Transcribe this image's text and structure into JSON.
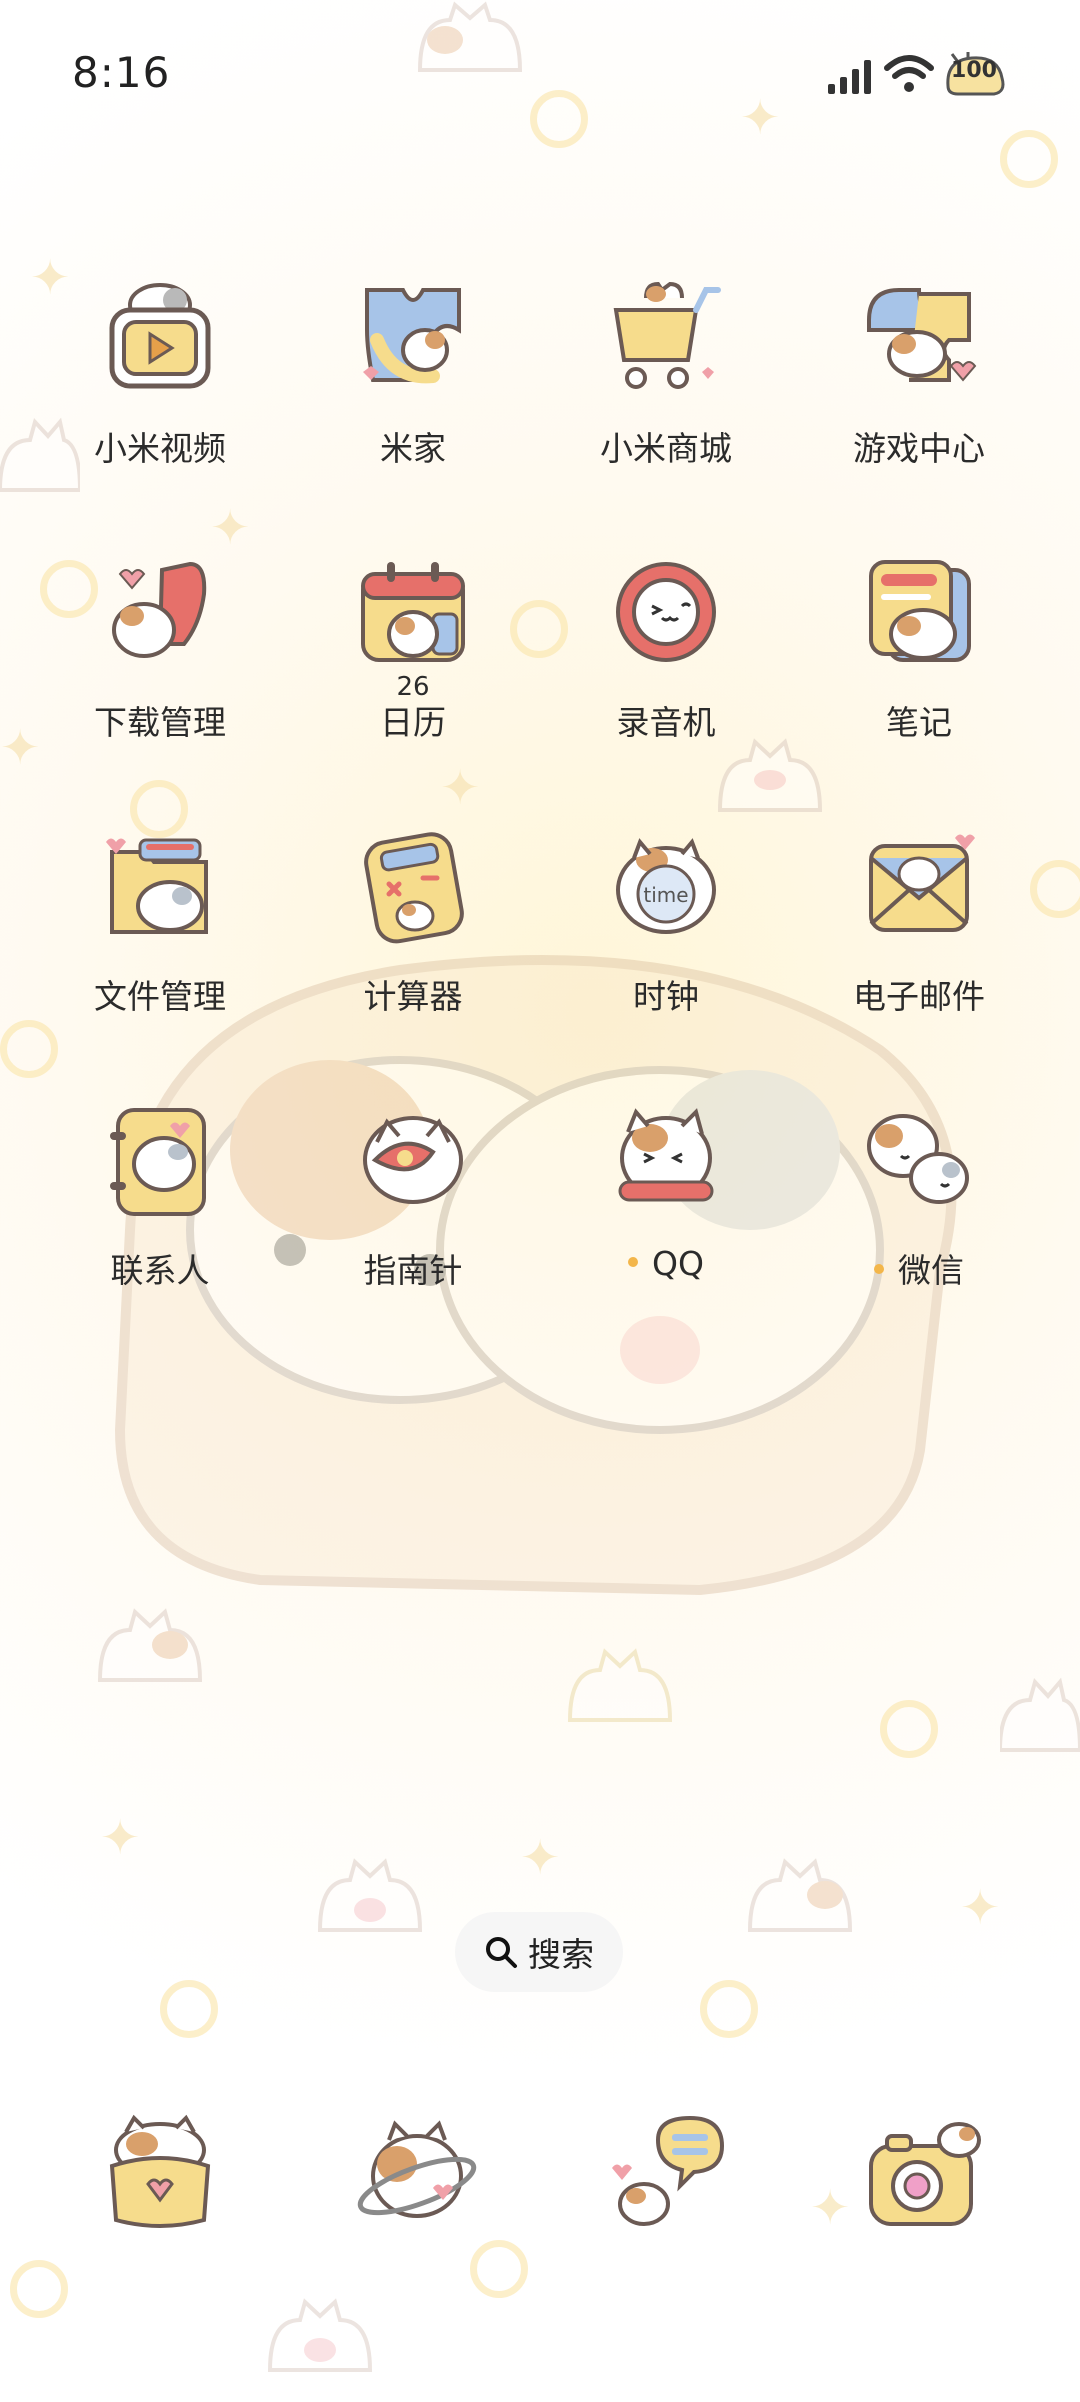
{
  "status_bar": {
    "time": "8:16",
    "battery_level": "100",
    "icons": [
      "signal-icon",
      "wifi-icon",
      "battery-icon"
    ]
  },
  "apps": [
    {
      "label": "小米视频",
      "icon": "video-icon"
    },
    {
      "label": "米家",
      "icon": "home-icon"
    },
    {
      "label": "小米商城",
      "icon": "shopping-cart-icon"
    },
    {
      "label": "游戏中心",
      "icon": "puzzle-icon"
    },
    {
      "label": "下载管理",
      "icon": "download-icon"
    },
    {
      "label": "日历",
      "icon": "calendar-icon",
      "date": "26"
    },
    {
      "label": "录音机",
      "icon": "recorder-icon"
    },
    {
      "label": "笔记",
      "icon": "notes-icon"
    },
    {
      "label": "文件管理",
      "icon": "folder-icon"
    },
    {
      "label": "计算器",
      "icon": "calculator-icon"
    },
    {
      "label": "时钟",
      "icon": "clock-icon",
      "icon_text": "time"
    },
    {
      "label": "电子邮件",
      "icon": "mail-icon"
    },
    {
      "label": "联系人",
      "icon": "contacts-icon"
    },
    {
      "label": "指南针",
      "icon": "compass-icon"
    },
    {
      "label": "QQ",
      "icon": "qq-icon",
      "new_dot": true
    },
    {
      "label": "微信",
      "icon": "wechat-icon",
      "new_dot": true
    }
  ],
  "search": {
    "label": "搜索"
  },
  "dock": [
    {
      "icon": "phone-icon"
    },
    {
      "icon": "browser-icon"
    },
    {
      "icon": "messages-icon"
    },
    {
      "icon": "camera-icon"
    }
  ],
  "colors": {
    "accent_yellow": "#f6dc8c",
    "icon_outline": "#6b5a54",
    "cat_orange": "#d9a06b",
    "pink": "#f0a0a8",
    "red": "#e6706a",
    "blue": "#a7c4e8",
    "dot": "#f3b64a"
  }
}
